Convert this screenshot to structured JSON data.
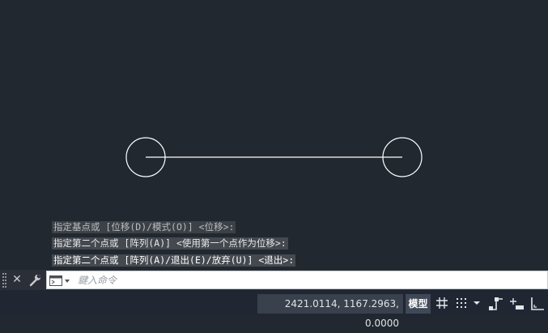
{
  "command_history": [
    "指定基点或 [位移(D)/模式(O)] <位移>:",
    "指定第二个点或 [阵列(A)] <使用第一个点作为位移>:",
    "指定第二个点或 [阵列(A)/退出(E)/放弃(U)] <退出>:"
  ],
  "command_line": {
    "placeholder": "鍵入命令"
  },
  "status_bar": {
    "coordinates": "2421.0114, 1167.2963, 0.0000",
    "model_label": "模型",
    "icons": [
      "grid-icon",
      "snap-grid-icon",
      "dropdown-arrow-icon",
      "ortho-icon",
      "dynamic-input-icon",
      "otrack-icon"
    ]
  },
  "colors": {
    "canvas": "#212830",
    "geometry": "#ffffff",
    "history_bg": "#44494f",
    "status_bg": "#202733"
  }
}
